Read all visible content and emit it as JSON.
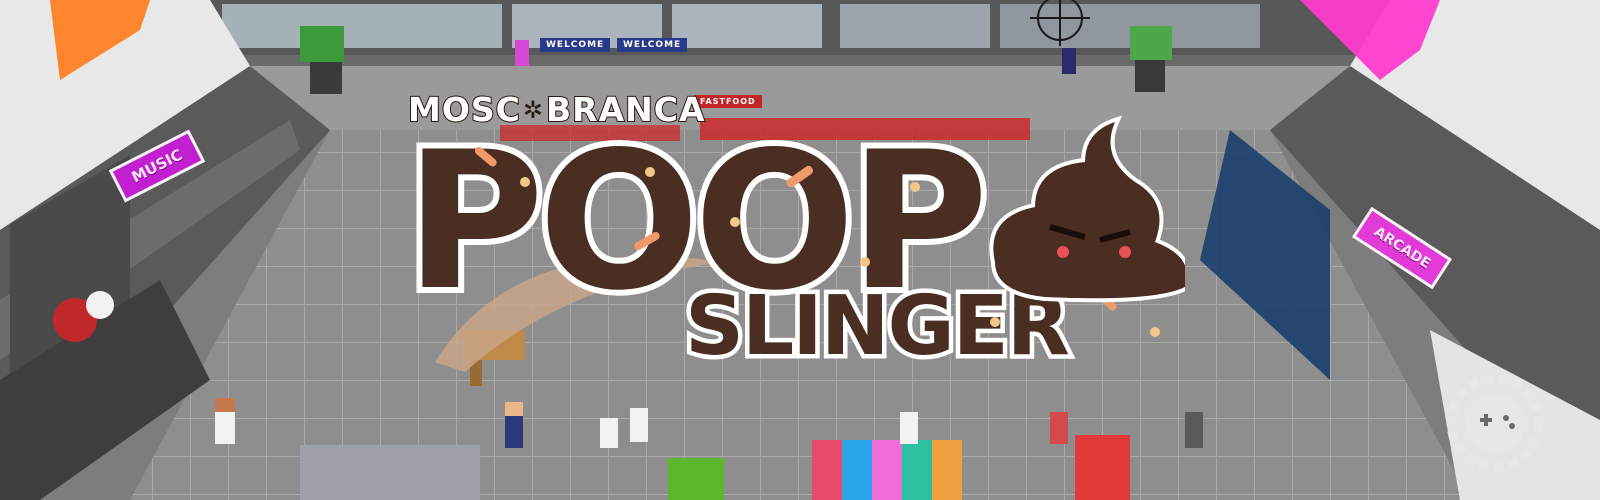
{
  "studio": {
    "name_left": "MOSC",
    "name_right": "BRANCA",
    "logo_icon": "fly-icon"
  },
  "game": {
    "title_top": "POOP",
    "title_bottom": "SLINGER"
  },
  "stores": {
    "music_sign": "MUSIC",
    "arcade_sign": "ARCADE",
    "welcome_sign_1": "WELCOME",
    "welcome_sign_2": "WELCOME",
    "fastfood_sign": "FASTFOOD"
  },
  "icons": [
    "crosshair-icon",
    "fly-icon",
    "poop-mascot-icon",
    "gear-controller-watermark-icon"
  ],
  "colors": {
    "poop_fill": "#4a2e22",
    "poop_outline": "#ffffff",
    "floor": "#8c8c8c",
    "magenta_sign": "#c21fd0",
    "orange_wall_sign": "#ff7a1a",
    "pink_wall_sign": "#ff3ccf"
  }
}
